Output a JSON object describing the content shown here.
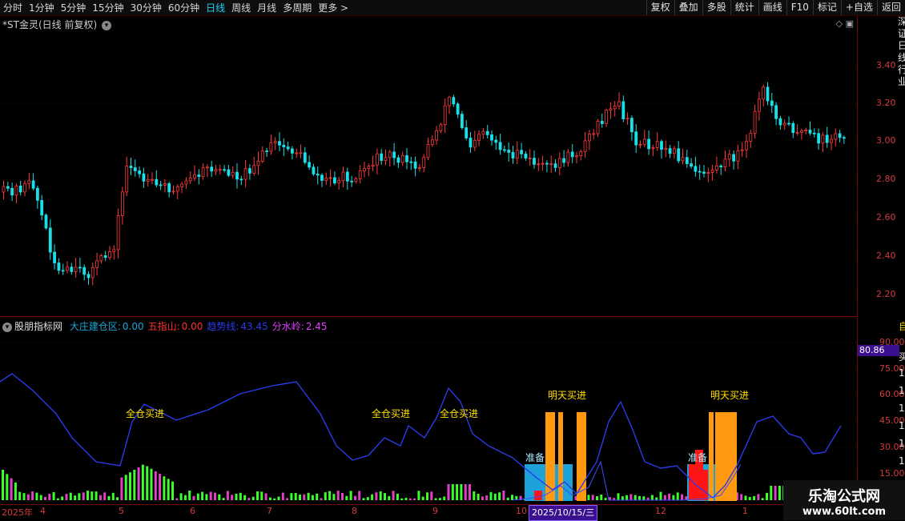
{
  "toolbar": {
    "periods": [
      "分时",
      "1分钟",
      "5分钟",
      "15分钟",
      "30分钟",
      "60分钟",
      "日线",
      "周线",
      "月线",
      "多周期",
      "更多 >"
    ],
    "active_period": "日线",
    "tools": [
      "复权",
      "叠加",
      "多股",
      "统计",
      "画线",
      "F10",
      "标记",
      "+自选",
      "返回"
    ]
  },
  "main": {
    "title": "*ST金灵(日线 前复权)",
    "y_ticks": [
      "3.40",
      "3.20",
      "3.00",
      "2.80",
      "2.60",
      "2.40",
      "2.20"
    ],
    "side_text": "深证日线行业"
  },
  "indicator": {
    "name": "股朋指标网",
    "lines": [
      {
        "label": "大庄建仓区:",
        "value": "0.00",
        "color": "#19a8d8"
      },
      {
        "label": "五指山:",
        "value": "0.00",
        "color": "#ff3030"
      },
      {
        "label": "趋势线:",
        "value": "43.45",
        "color": "#2a3ae8"
      },
      {
        "label": "分水岭:",
        "value": "2.45",
        "color": "#e040ff"
      }
    ],
    "y_ticks": [
      "90.00",
      "75.00",
      "60.00",
      "45.00",
      "30.00",
      "15.00"
    ],
    "highlight_value": "80.86",
    "annotations": [
      "全仓买进",
      "全仓买进",
      "全仓买进",
      "明天买进",
      "明天买进",
      "准备",
      "准备"
    ],
    "right_edge": [
      "自",
      "买",
      "1",
      "1",
      "1",
      "1",
      "1",
      "1"
    ]
  },
  "xaxis": {
    "labels": [
      "2025年",
      "4",
      "5",
      "6",
      "7",
      "8",
      "9",
      "10",
      "12",
      "1"
    ],
    "cursor_date": "2025/10/15/三"
  },
  "watermark": {
    "name": "乐淘公式网",
    "url": "www.60lt.com"
  },
  "colors": {
    "up": "#ff3a3a",
    "down": "#19e0e8",
    "grid": "#6a0b0b",
    "trend": "#2a3ae8"
  }
}
